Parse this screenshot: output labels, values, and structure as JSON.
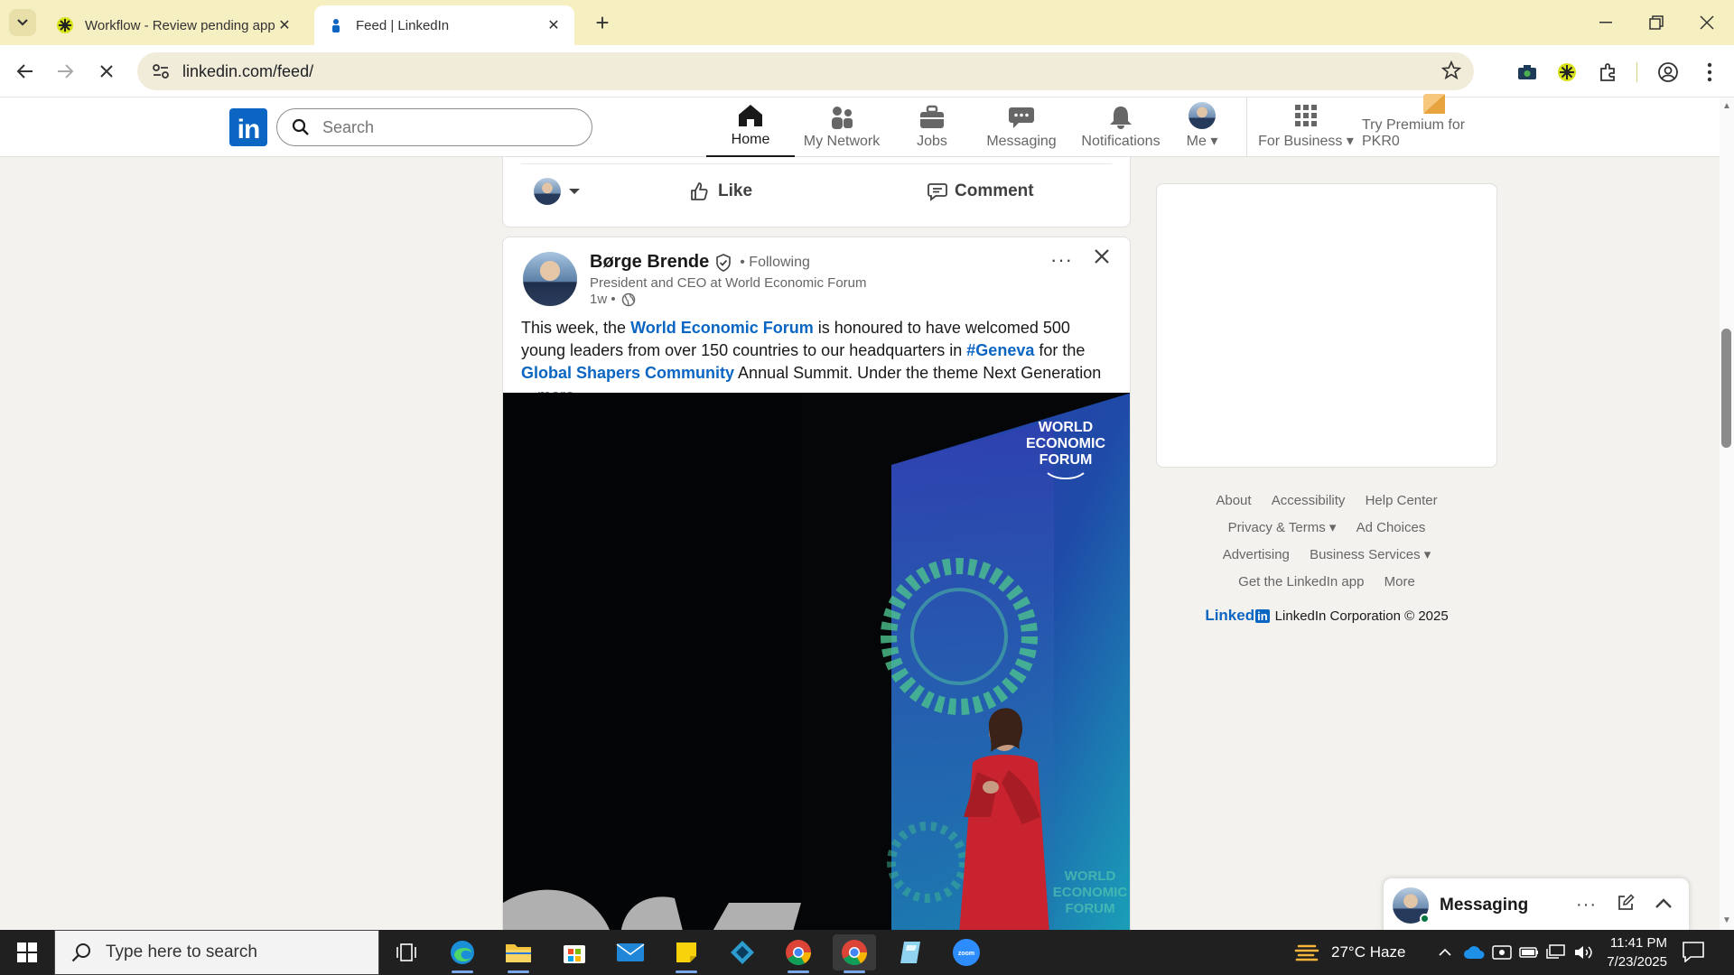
{
  "browser": {
    "tabs": [
      {
        "title": "Workflow - Review pending app",
        "active": false
      },
      {
        "title": "Feed | LinkedIn",
        "active": true
      }
    ],
    "url": "linkedin.com/feed/"
  },
  "linkedin": {
    "search_placeholder": "Search",
    "nav": [
      {
        "label": "Home",
        "icon": "home-icon",
        "active": true
      },
      {
        "label": "My Network",
        "icon": "network-icon",
        "active": false
      },
      {
        "label": "Jobs",
        "icon": "briefcase-icon",
        "active": false
      },
      {
        "label": "Messaging",
        "icon": "chat-icon",
        "active": false
      },
      {
        "label": "Notifications",
        "icon": "bell-icon",
        "active": false
      },
      {
        "label": "Me",
        "icon": "avatar",
        "active": false
      },
      {
        "label": "For Business",
        "icon": "grid-icon",
        "active": false
      },
      {
        "label": "Try Premium for PKR0",
        "icon": "premium-icon",
        "active": false
      }
    ]
  },
  "prev_post_actions": {
    "like": "Like",
    "comment": "Comment"
  },
  "post": {
    "author": "Børge Brende",
    "following": "• Following",
    "headline": "President and CEO at World Economic Forum",
    "time": "1w •",
    "text_parts": [
      {
        "t": "This week, the ",
        "link": false
      },
      {
        "t": "World Economic Forum",
        "link": true
      },
      {
        "t": " is honoured to have welcomed 500 young leaders from over 150 countries to our headquarters in ",
        "link": false
      },
      {
        "t": "#Geneva",
        "link": true
      },
      {
        "t": " for the ",
        "link": false
      },
      {
        "t": "Global Shapers Community",
        "link": true
      },
      {
        "t": " Annual Summit. Under the theme Next Generation ",
        "link": false
      }
    ],
    "more": "…more",
    "image_logo": [
      "WORLD",
      "ECONOMIC",
      "FORUM"
    ]
  },
  "footer": {
    "row1": [
      "About",
      "Accessibility",
      "Help Center"
    ],
    "row2": [
      "Privacy & Terms ▾",
      "Ad Choices"
    ],
    "row3": [
      "Advertising",
      "Business Services ▾"
    ],
    "row4": [
      "Get the LinkedIn app",
      "More"
    ],
    "brand": "Linked",
    "brand_in": "in",
    "copyright": "LinkedIn Corporation © 2025"
  },
  "messaging": {
    "label": "Messaging"
  },
  "taskbar": {
    "search_placeholder": "Type here to search",
    "weather": "27°C  Haze",
    "time": "11:41 PM",
    "date": "7/23/2025"
  },
  "colors": {
    "brand": "#0a66c2",
    "tabbar": "#f6efc1",
    "link": "#0a66c2"
  }
}
